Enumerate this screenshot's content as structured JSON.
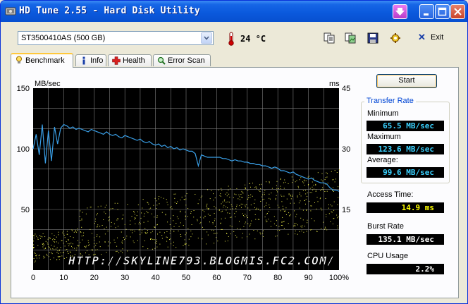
{
  "window": {
    "title": "HD Tune 2.55 - Hard Disk Utility"
  },
  "toolbar": {
    "drive": "ST3500410AS (500 GB)",
    "temperature": "24 °C",
    "exit_label": "Exit",
    "icons": [
      "copy-info-icon",
      "copy-screenshot-icon",
      "save-icon",
      "options-icon"
    ]
  },
  "tabs": [
    {
      "label": "Benchmark",
      "icon": "lightbulb-icon",
      "active": true
    },
    {
      "label": "Info",
      "icon": "info-icon",
      "active": false
    },
    {
      "label": "Health",
      "icon": "health-cross-icon",
      "active": false
    },
    {
      "label": "Error Scan",
      "icon": "magnifier-icon",
      "active": false
    }
  ],
  "benchmark": {
    "start_label": "Start",
    "transfer_rate": {
      "title": "Transfer Rate",
      "minimum_label": "Minimum",
      "minimum": "65.5 MB/sec",
      "maximum_label": "Maximum",
      "maximum": "123.6 MB/sec",
      "average_label": "Average:",
      "average": "99.6 MB/sec"
    },
    "access_time_label": "Access Time:",
    "access_time": "14.9 ms",
    "burst_rate_label": "Burst Rate",
    "burst_rate": "135.1 MB/sec",
    "cpu_usage_label": "CPU Usage",
    "cpu_usage": "2.2%",
    "watermark": "HTTP://SKYLINE793.BLOGMIS.FC2.COM/"
  },
  "colors": {
    "transfer_line": "#3aa0e8",
    "access_points": "#e8e84a",
    "chart_background": "#000000",
    "grid": "#808080"
  },
  "chart_data": {
    "type": "line",
    "ylabel": "MB/sec",
    "y2label": "ms",
    "ylim": [
      0,
      150
    ],
    "y2lim": [
      0,
      45
    ],
    "xlim": [
      0,
      100
    ],
    "x_unit": "%",
    "xticks": [
      "0",
      "10",
      "20",
      "30",
      "40",
      "50",
      "60",
      "70",
      "80",
      "90",
      "100%"
    ],
    "yticks": [
      "150",
      "100",
      "50"
    ],
    "y2ticks": [
      "45",
      "30",
      "15"
    ],
    "grid": true,
    "series": [
      {
        "x": [
          0,
          1,
          2,
          3,
          4,
          5,
          6,
          7,
          8,
          9,
          10,
          11,
          12,
          13,
          14,
          15,
          16,
          17,
          18,
          19,
          20,
          21,
          22,
          23,
          24,
          25,
          26,
          27,
          28,
          29,
          30,
          31,
          32,
          33,
          34,
          35,
          36,
          37,
          38,
          39,
          40,
          41,
          42,
          43,
          44,
          45,
          46,
          47,
          48,
          49,
          50,
          51,
          52,
          53,
          54,
          55,
          56,
          57,
          58,
          59,
          60,
          61,
          62,
          63,
          64,
          65,
          66,
          67,
          68,
          69,
          70,
          71,
          72,
          73,
          74,
          75,
          76,
          77,
          78,
          79,
          80,
          81,
          82,
          83,
          84,
          85,
          86,
          87,
          88,
          89,
          90,
          91,
          92,
          93,
          94,
          95,
          96,
          97,
          98,
          99,
          100
        ],
        "y": [
          100,
          112,
          95,
          120,
          88,
          115,
          90,
          118,
          104,
          117,
          120,
          119,
          117,
          118,
          116,
          117,
          116,
          115,
          114,
          116,
          115,
          114,
          113,
          112,
          114,
          112,
          111,
          112,
          110,
          109,
          111,
          110,
          109,
          108,
          107,
          108,
          106,
          105,
          106,
          104,
          103,
          104,
          102,
          103,
          101,
          102,
          100,
          101,
          99,
          100,
          99,
          98,
          98,
          96,
          86,
          95,
          94,
          93,
          93,
          93,
          93,
          93,
          92,
          92,
          91,
          90,
          91,
          90,
          90,
          89,
          89,
          88,
          88,
          87,
          87,
          86,
          86,
          85,
          84,
          85,
          84,
          82,
          82,
          81,
          80,
          81,
          79,
          78,
          77,
          76,
          75,
          76,
          74,
          73,
          72,
          72,
          71,
          68,
          66,
          66,
          65
        ]
      }
    ]
  }
}
